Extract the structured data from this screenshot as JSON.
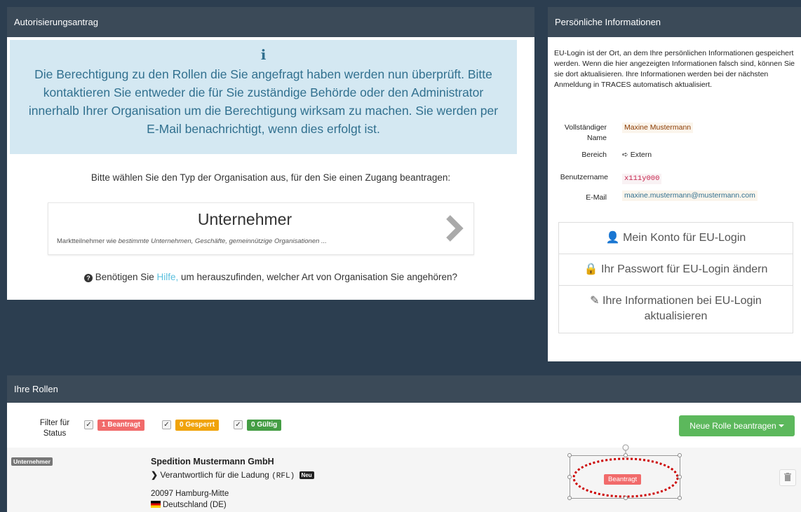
{
  "auth_panel": {
    "title": "Autorisierungsantrag",
    "info_icon": "info-icon",
    "info_message": "Die Berechtigung zu den Rollen die Sie angefragt haben werden nun überprüft. Bitte kontaktieren Sie entweder die für Sie zuständige Behörde oder den Administrator innerhalb Ihrer Organisation um die Berechtigung wirksam zu machen. Sie werden per E-Mail benachrichtigt, wenn dies erfolgt ist.",
    "choose_text": "Bitte wählen Sie den Typ der Organisation aus, für den Sie einen Zugang beantragen:",
    "org_card": {
      "title": "Unternehmer",
      "desc_prefix": "Marktteilnehmer wie ",
      "desc_italic": "bestimmte Unternehmen, Geschäfte, gemeinnützige Organisationen ..."
    },
    "help_prefix": "Benötigen Sie ",
    "help_link": "Hilfe,",
    "help_suffix": " um herauszufinden, welcher Art von Organisation Sie angehören?"
  },
  "personal_panel": {
    "title": "Persönliche Informationen",
    "intro": "EU-Login ist der Ort, an dem Ihre persönlichen Informationen gespeichert werden. Wenn die hier angezeigten Informationen falsch sind, können Sie sie dort aktualisieren. Ihre Informationen werden bei der nächsten Anmeldung in TRACES automatisch aktualisiert.",
    "fields": {
      "name_label_1": "Vollständiger",
      "name_label_2": "Name",
      "name_value": "Maxine Mustermann",
      "area_label": "Bereich",
      "area_value": "Extern",
      "user_label": "Benutzername",
      "user_value": "x111y000",
      "email_label": "E-Mail",
      "email_value": "maxine.mustermann@mustermann.com"
    },
    "actions": [
      {
        "label": "Mein Konto für EU-Login",
        "icon": "user-icon"
      },
      {
        "label": "Ihr Passwort für EU-Login ändern",
        "icon": "lock-icon"
      },
      {
        "label": "Ihre Informationen bei EU-Login aktualisieren",
        "icon": "pencil-icon"
      }
    ]
  },
  "roles": {
    "title": "Ihre Rollen",
    "filter_label_1": "Filter für",
    "filter_label_2": "Status",
    "filters": [
      {
        "label": "1 Beantragt",
        "color": "#f16b6b"
      },
      {
        "label": "0 Gesperrt",
        "color": "#f0a30a"
      },
      {
        "label": "0 Gültig",
        "color": "#449d44"
      }
    ],
    "new_role_button": "Neue Rolle beantragen",
    "row": {
      "type": "Unternehmer",
      "company": "Spedition Mustermann GmbH",
      "responsibility": "Verantwortlich für die Ladung",
      "code": "(RFL)",
      "new_badge": "Neu",
      "address": "20097 Hamburg-Mitte",
      "country": "Deutschland (DE)",
      "status": "Beantragt"
    }
  }
}
